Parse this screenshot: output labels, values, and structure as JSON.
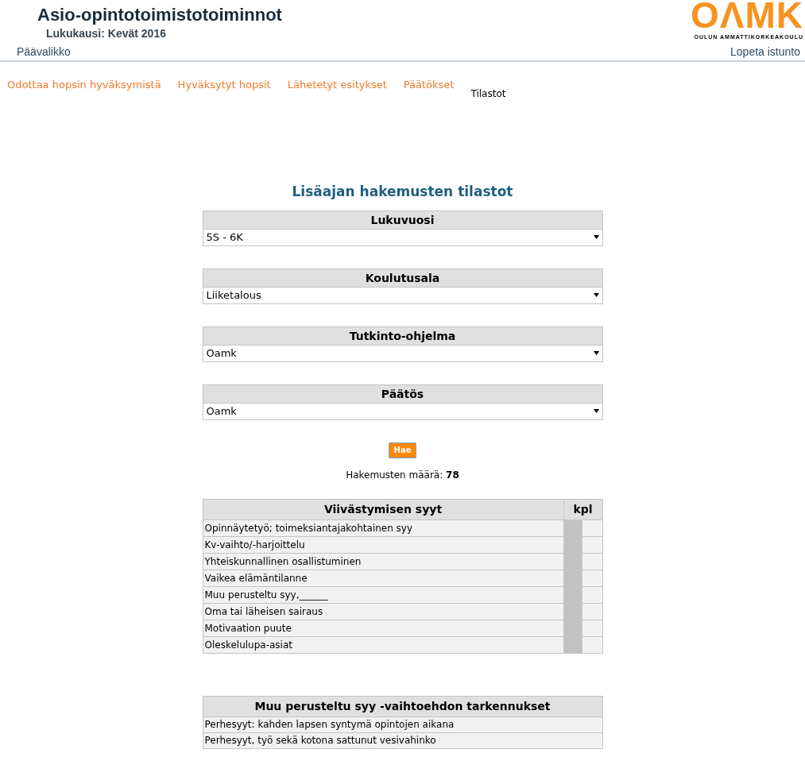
{
  "header": {
    "title": "Asio-opintotoimistotoiminnot",
    "subtitle": "Lukukausi: Kevät 2016",
    "logo_text": "OΛMK",
    "logo_caption": "OULUN AMMATTIKORKEAKOULU"
  },
  "nav": {
    "left": "Päävalikko",
    "right": "Lopeta istunto"
  },
  "tabs": [
    {
      "label": "Odottaa hopsin hyväksymistä",
      "selected": false
    },
    {
      "label": "Hyväksytyt hopsit",
      "selected": false
    },
    {
      "label": "Lähetetyt esitykset",
      "selected": false
    },
    {
      "label": "Päätökset",
      "selected": false
    },
    {
      "label": "Tilastot",
      "selected": true
    }
  ],
  "page_title": "Lisäajan hakemusten tilastot",
  "filters": [
    {
      "label": "Lukuvuosi",
      "value": "5S - 6K"
    },
    {
      "label": "Koulutusala",
      "value": "Liiketalous"
    },
    {
      "label": "Tutkinto-ohjelma",
      "value": "Oamk"
    },
    {
      "label": "Päätös",
      "value": "Oamk"
    }
  ],
  "search_button": "Hae",
  "count": {
    "label": "Hakemusten määrä:",
    "value": "78"
  },
  "reasons_table": {
    "columns": [
      "Viivästymisen syyt",
      "kpl"
    ],
    "rows": [
      "Opinnäytetyö; toimeksiantajakohtainen syy",
      "Kv-vaihto/-harjoittelu",
      "Yhteiskunnallinen osallistuminen",
      "Vaikea elämäntilanne",
      "Muu perusteltu syy,______",
      "Oma tai läheisen sairaus",
      "Motivaation puute",
      "Oleskelulupa-asiat"
    ]
  },
  "details_table": {
    "title": "Muu perusteltu syy -vaihtoehdon tarkennukset",
    "rows": [
      "Perhesyyt: kahden lapsen syntymä opintojen aikana",
      "Perhesyyt, työ sekä kotona sattunut vesivahinko"
    ]
  }
}
